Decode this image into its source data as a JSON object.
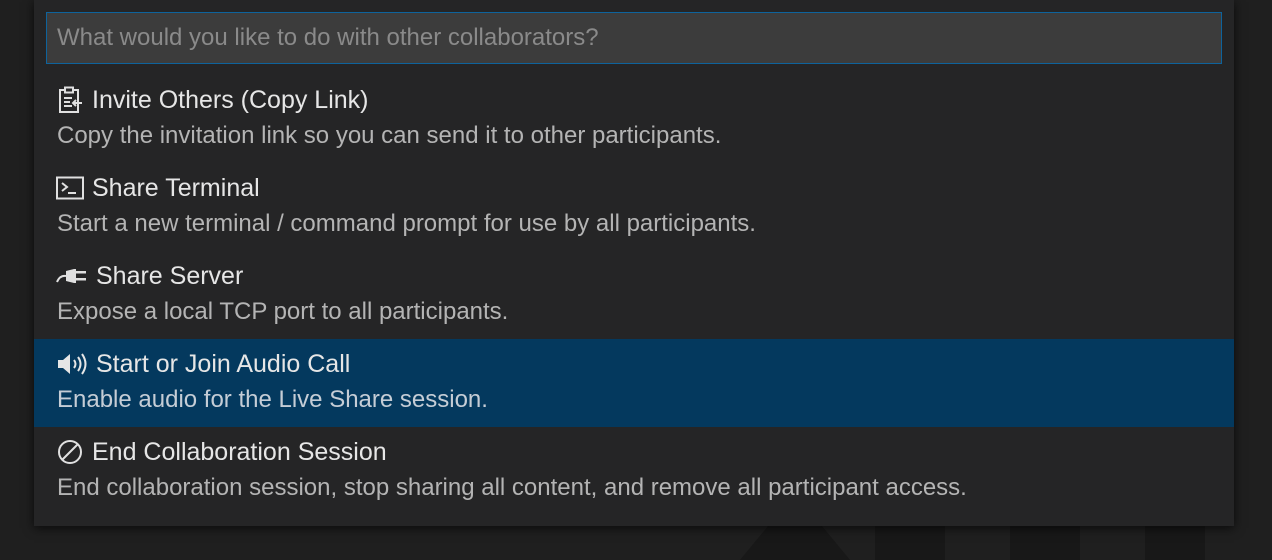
{
  "quick_pick": {
    "placeholder": "What would you like to do with other collaborators?",
    "value": "",
    "items": [
      {
        "icon": "clipboard-icon",
        "label": "Invite Others (Copy Link)",
        "description": "Copy the invitation link so you can send it to other participants.",
        "selected": false
      },
      {
        "icon": "terminal-icon",
        "label": "Share Terminal",
        "description": "Start a new terminal / command prompt for use by all participants.",
        "selected": false
      },
      {
        "icon": "plug-icon",
        "label": "Share Server",
        "description": "Expose a local TCP port to all participants.",
        "selected": false
      },
      {
        "icon": "speaker-icon",
        "label": "Start or Join Audio Call",
        "description": "Enable audio for the Live Share session.",
        "selected": true
      },
      {
        "icon": "circle-slash-icon",
        "label": "End Collaboration Session",
        "description": "End collaboration session, stop sharing all content, and remove all participant access.",
        "selected": false
      }
    ]
  },
  "colors": {
    "panel_bg": "#252526",
    "selected_bg": "#04395e",
    "input_bg": "#3c3c3c",
    "input_border": "#0e639c"
  }
}
